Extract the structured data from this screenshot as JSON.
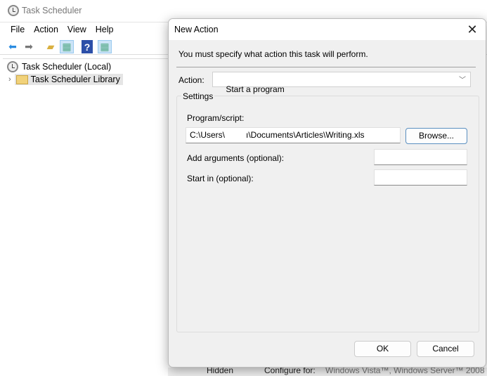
{
  "window": {
    "title": "Task Scheduler",
    "menu": [
      "File",
      "Action",
      "View",
      "Help"
    ]
  },
  "tree": {
    "root": "Task Scheduler (Local)",
    "library": "Task Scheduler Library"
  },
  "background": {
    "hidden_label": "Hidden",
    "configure_label": "Configure for:",
    "configure_value": "Windows Vista™, Windows Server™ 2008"
  },
  "dialog": {
    "title": "New Action",
    "instruction": "You must specify what action this task will perform.",
    "action_label": "Action:",
    "action_value": "Start a program",
    "settings_label": "Settings",
    "program_label": "Program/script:",
    "program_value": "C:\\Users\\         ı\\Documents\\Articles\\Writing.xls",
    "browse": "Browse...",
    "arguments_label": "Add arguments (optional):",
    "arguments_value": "",
    "startin_label": "Start in (optional):",
    "startin_value": "",
    "ok": "OK",
    "cancel": "Cancel"
  }
}
